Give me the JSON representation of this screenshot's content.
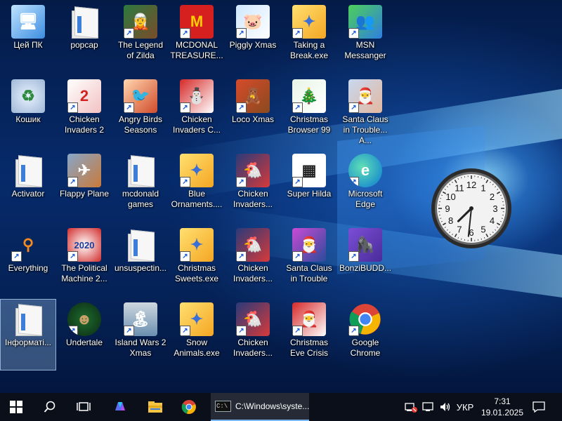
{
  "desktop": {
    "icons": [
      {
        "label": "Цей ПК",
        "icon": "this-pc-icon",
        "shortcut": false,
        "selected": false
      },
      {
        "label": "popcap",
        "icon": "popcap-folder-icon",
        "shortcut": false,
        "selected": false
      },
      {
        "label": "The Legend of Zilda",
        "icon": "zilda-game-icon",
        "shortcut": true,
        "selected": false
      },
      {
        "label": "MCDONAL TREASURE...",
        "icon": "mcdonalds-icon",
        "shortcut": true,
        "selected": false
      },
      {
        "label": "Piggly Xmas",
        "icon": "piggly-xmas-icon",
        "shortcut": true,
        "selected": false
      },
      {
        "label": "Taking a Break.exe",
        "icon": "screensaver-exe-icon",
        "shortcut": true,
        "selected": false
      },
      {
        "label": "MSN Messanger",
        "icon": "msn-messenger-icon",
        "shortcut": true,
        "selected": false
      },
      {
        "label": "Кошик",
        "icon": "recycle-bin-icon",
        "shortcut": false,
        "selected": false
      },
      {
        "label": "Chicken Invaders 2",
        "icon": "chicken-invaders-2-icon",
        "shortcut": true,
        "selected": false
      },
      {
        "label": "Angry Birds Seasons",
        "icon": "angry-birds-icon",
        "shortcut": true,
        "selected": false
      },
      {
        "label": "Chicken Invaders C...",
        "icon": "chicken-invaders-christmas-icon",
        "shortcut": true,
        "selected": false
      },
      {
        "label": "Loco Xmas",
        "icon": "loco-xmas-icon",
        "shortcut": true,
        "selected": false
      },
      {
        "label": "Christmas Browser 99",
        "icon": "christmas-tree-icon",
        "shortcut": true,
        "selected": false
      },
      {
        "label": "Santa Claus in Trouble... A...",
        "icon": "santa-icon",
        "shortcut": true,
        "selected": false
      },
      {
        "label": "Activator",
        "icon": "activator-folder-icon",
        "shortcut": false,
        "selected": false
      },
      {
        "label": "Flappy Plane",
        "icon": "flappy-plane-icon",
        "shortcut": true,
        "selected": false
      },
      {
        "label": "mcdonald games",
        "icon": "mcdonald-games-folder-icon",
        "shortcut": false,
        "selected": false
      },
      {
        "label": "Blue Ornaments....",
        "icon": "screensaver-exe-icon",
        "shortcut": true,
        "selected": false
      },
      {
        "label": "Chicken Invaders...",
        "icon": "chicken-invaders-icon",
        "shortcut": true,
        "selected": false
      },
      {
        "label": "Super Hilda",
        "icon": "super-hilda-icon",
        "shortcut": true,
        "selected": false
      },
      {
        "label": "Microsoft Edge",
        "icon": "edge-icon",
        "shortcut": true,
        "selected": false
      },
      {
        "label": "Everything",
        "icon": "everything-search-icon",
        "shortcut": true,
        "selected": false
      },
      {
        "label": "The Political Machine 2...",
        "icon": "political-machine-icon",
        "shortcut": true,
        "selected": false
      },
      {
        "label": "unsuspectin...",
        "icon": "unsuspecting-folder-icon",
        "shortcut": false,
        "selected": false
      },
      {
        "label": "Christmas Sweets.exe",
        "icon": "screensaver-exe-icon",
        "shortcut": true,
        "selected": false
      },
      {
        "label": "Chicken Invaders...",
        "icon": "chicken-invaders-icon",
        "shortcut": true,
        "selected": false
      },
      {
        "label": "Santa Claus in Trouble",
        "icon": "santa-trouble-icon",
        "shortcut": true,
        "selected": false
      },
      {
        "label": "BonziBUDD...",
        "icon": "bonzibuddy-icon",
        "shortcut": true,
        "selected": false
      },
      {
        "label": "Інформаті...",
        "icon": "info-folder-icon",
        "shortcut": false,
        "selected": true
      },
      {
        "label": "Undertale",
        "icon": "undertale-icon",
        "shortcut": true,
        "selected": false
      },
      {
        "label": "Island Wars 2 Xmas",
        "icon": "island-wars-icon",
        "shortcut": true,
        "selected": false
      },
      {
        "label": "Snow Animals.exe",
        "icon": "screensaver-exe-icon",
        "shortcut": true,
        "selected": false
      },
      {
        "label": "Chicken Invaders...",
        "icon": "chicken-invaders-icon",
        "shortcut": true,
        "selected": false
      },
      {
        "label": "Christmas Eve Crisis",
        "icon": "christmas-eve-santa-icon",
        "shortcut": true,
        "selected": false
      },
      {
        "label": "Google Chrome",
        "icon": "chrome-icon",
        "shortcut": true,
        "selected": false
      }
    ]
  },
  "gadget": {
    "name": "clock-gadget",
    "numbers": [
      "12",
      "1",
      "2",
      "3",
      "4",
      "5",
      "6",
      "7",
      "8",
      "9",
      "10",
      "11"
    ],
    "hour": 7,
    "minute": 31
  },
  "taskbar": {
    "start_icon": "windows-logo-icon",
    "search_icon": "search-icon",
    "taskview_icon": "task-view-icon",
    "pinned": [
      {
        "name": "copilot-icon"
      },
      {
        "name": "file-explorer-icon"
      },
      {
        "name": "chrome-icon"
      }
    ],
    "active_task": {
      "label": "C:\\Windows\\syste...",
      "icon": "cmd-icon",
      "icon_text": "C:\\"
    },
    "tray": {
      "icons": [
        "network-alert-icon",
        "network-icon",
        "volume-icon"
      ],
      "language": "УКР",
      "time": "7:31",
      "date": "19.01.2025",
      "notification_icon": "notification-icon"
    }
  },
  "colors": {
    "taskbar_bg": "#0b0f19",
    "accent": "#79b8f3"
  }
}
